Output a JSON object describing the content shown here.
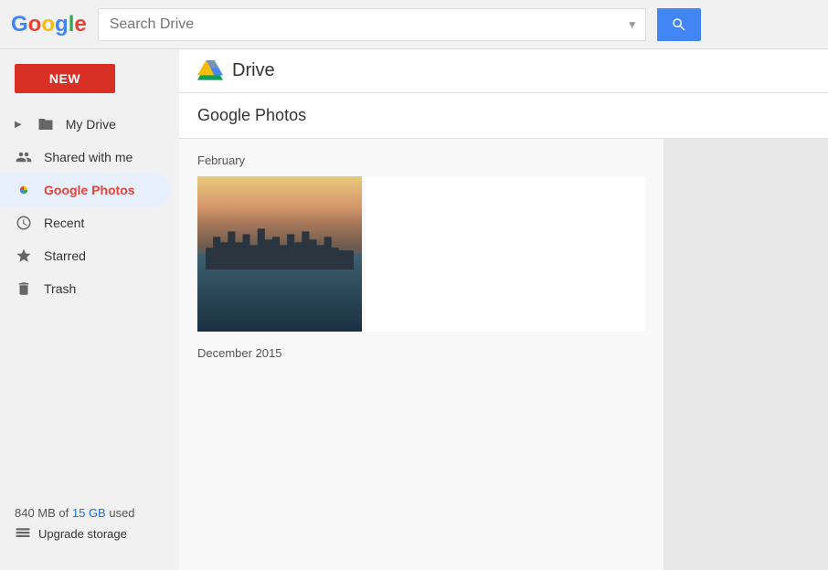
{
  "header": {
    "search_placeholder": "Search Drive",
    "drive_title": "Drive"
  },
  "google_logo": {
    "letters": [
      "G",
      "o",
      "o",
      "g",
      "l",
      "e"
    ]
  },
  "sidebar": {
    "new_button_label": "NEW",
    "items": [
      {
        "id": "my-drive",
        "label": "My Drive",
        "icon": "folder",
        "active": false,
        "expandable": true
      },
      {
        "id": "shared",
        "label": "Shared with me",
        "icon": "people",
        "active": false
      },
      {
        "id": "photos",
        "label": "Google Photos",
        "icon": "pinwheel",
        "active": true
      },
      {
        "id": "recent",
        "label": "Recent",
        "icon": "clock",
        "active": false
      },
      {
        "id": "starred",
        "label": "Starred",
        "icon": "star",
        "active": false
      },
      {
        "id": "trash",
        "label": "Trash",
        "icon": "trash",
        "active": false
      }
    ],
    "storage_text": "840 MB of ",
    "storage_limit": "15 GB",
    "storage_suffix": " used",
    "upgrade_label": "Upgrade storage"
  },
  "main": {
    "page_title": "Google Photos",
    "sections": [
      {
        "month": "February",
        "photos": [
          {
            "id": "photo-1",
            "alt": "Chinese village waterfront at sunset"
          }
        ]
      },
      {
        "month": "December 2015",
        "photos": []
      }
    ]
  }
}
